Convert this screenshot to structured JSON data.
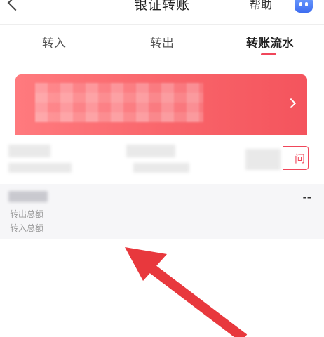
{
  "header": {
    "title": "银证转账",
    "help_label": "帮助"
  },
  "tabs": [
    {
      "label": "转入"
    },
    {
      "label": "转出"
    },
    {
      "label": "转账流水"
    }
  ],
  "active_tab": "转账流水",
  "query_button_label": "问",
  "summary": {
    "main_value": "--",
    "rows": [
      {
        "label": "转出总额",
        "value": "--"
      },
      {
        "label": "转入总额",
        "value": "--"
      }
    ]
  },
  "colors": {
    "accent": "#f0465a",
    "card_gradient_start": "#ff7a7e",
    "card_gradient_end": "#f4545d",
    "annotation_arrow": "#e8383d"
  },
  "icons": [
    "back-icon",
    "assistant-bot-icon",
    "chevron-right-icon"
  ]
}
